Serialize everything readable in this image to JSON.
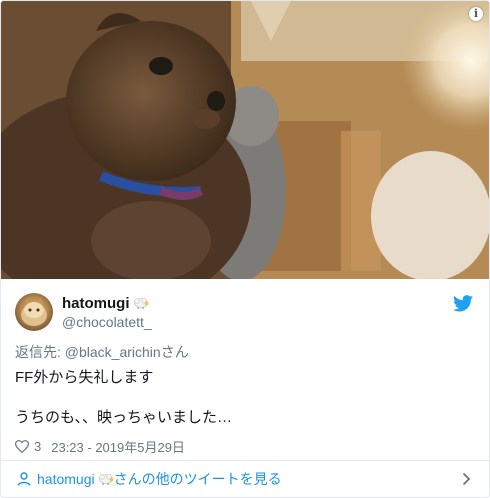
{
  "tweet": {
    "display_name": "hatomugi",
    "handle": "@chocolatett_",
    "reply_prefix": "返信先: ",
    "reply_mention": "@black_arichinさん",
    "text": "FF外から失礼します\n\nうちのも、、映っちゃいました…",
    "like_count": "3",
    "timestamp": "23:23 - 2019年5月29日"
  },
  "footer": {
    "name": "hatomugi",
    "suffix": "さんの他のツイートを見る"
  },
  "icons": {
    "info": "info-icon",
    "bird": "twitter-bird-icon",
    "heart": "heart-icon",
    "person": "person-icon",
    "chevron": "chevron-right-icon",
    "emoji": "sheep-emoji-icon"
  },
  "colors": {
    "link": "#1b95e0",
    "secondary_text": "#657786",
    "twitter_blue": "#1da1f2",
    "border": "#e1e8ed"
  }
}
